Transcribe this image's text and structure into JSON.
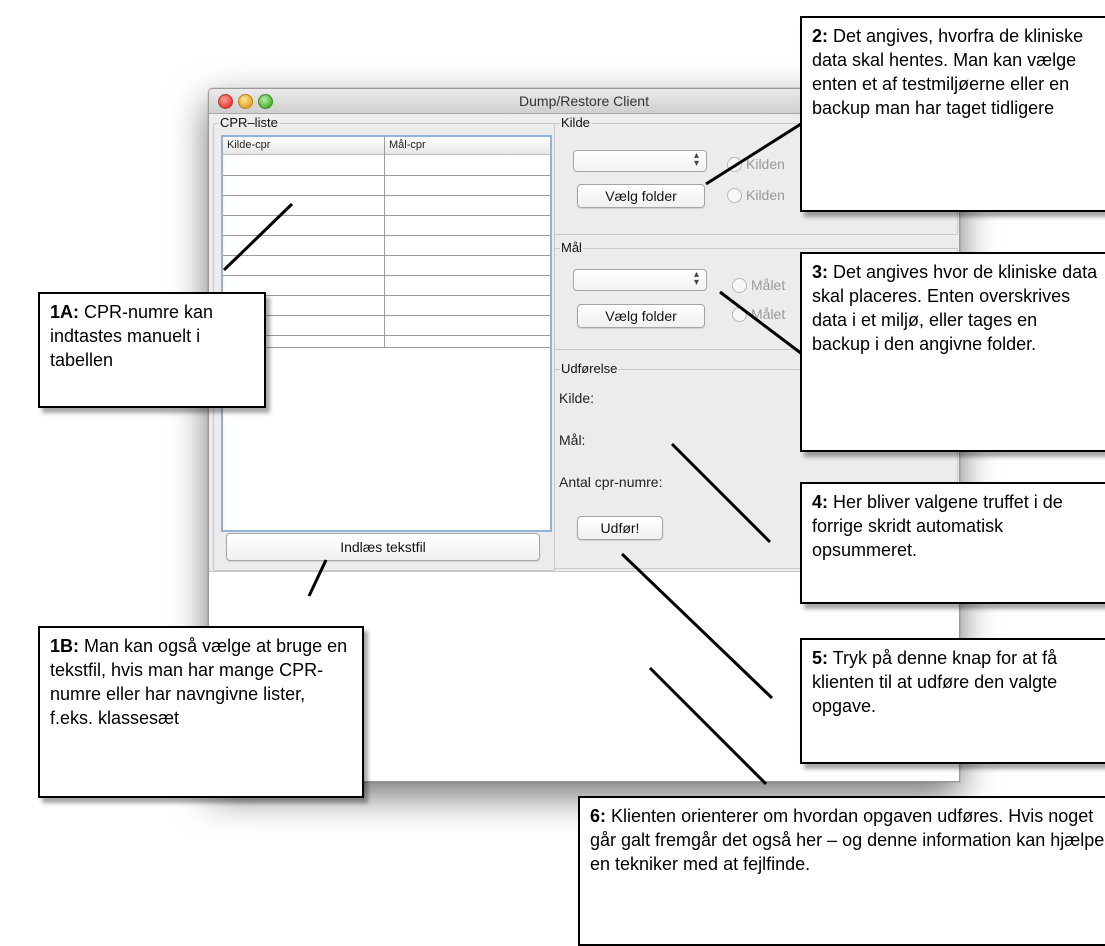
{
  "window": {
    "title": "Dump/Restore Client",
    "cpr_panel": {
      "legend": "CPR–liste",
      "columns": [
        "Kilde-cpr",
        "Mål-cpr"
      ],
      "load_button": "Indlæs tekstfil"
    },
    "source_panel": {
      "legend": "Kilde",
      "folder_button": "Vælg folder",
      "radio_1": "Kilden",
      "radio_2": "Kilden"
    },
    "target_panel": {
      "legend": "Mål",
      "folder_button": "Vælg folder",
      "radio_1": "Målet",
      "radio_2": "Målet"
    },
    "execution_panel": {
      "legend": "Udførelse",
      "source_label": "Kilde:",
      "target_label": "Mål:",
      "count_label": "Antal cpr-numre:",
      "execute_button": "Udfør!"
    }
  },
  "callouts": {
    "c1a": {
      "num": "1A:",
      "text": " CPR-numre kan indtastes manuelt i tabellen"
    },
    "c1b": {
      "num": "1B:",
      "text": " Man kan også vælge at bruge en tekstfil, hvis man har mange CPR-numre eller har navngivne lister, f.eks. klassesæt"
    },
    "c2": {
      "num": "2:",
      "text": " Det angives, hvorfra de kliniske data skal hentes. Man kan vælge enten et af testmiljøerne eller en backup man har taget tidligere"
    },
    "c3": {
      "num": "3:",
      "text": " Det angives hvor de kliniske data skal placeres. Enten overskrives data i et miljø, eller tages en backup i den angivne folder."
    },
    "c4": {
      "num": "4:",
      "text": " Her bliver valgene truffet i de forrige skridt automatisk opsummeret."
    },
    "c5": {
      "num": "5:",
      "text": " Tryk på denne knap for at få klienten til at udføre den valgte opgave."
    },
    "c6": {
      "num": "6:",
      "text": " Klienten orienterer om hvordan opgaven udføres. Hvis noget går galt fremgår det også her – og denne information kan hjælpe en tekniker med at fejlfinde."
    }
  }
}
